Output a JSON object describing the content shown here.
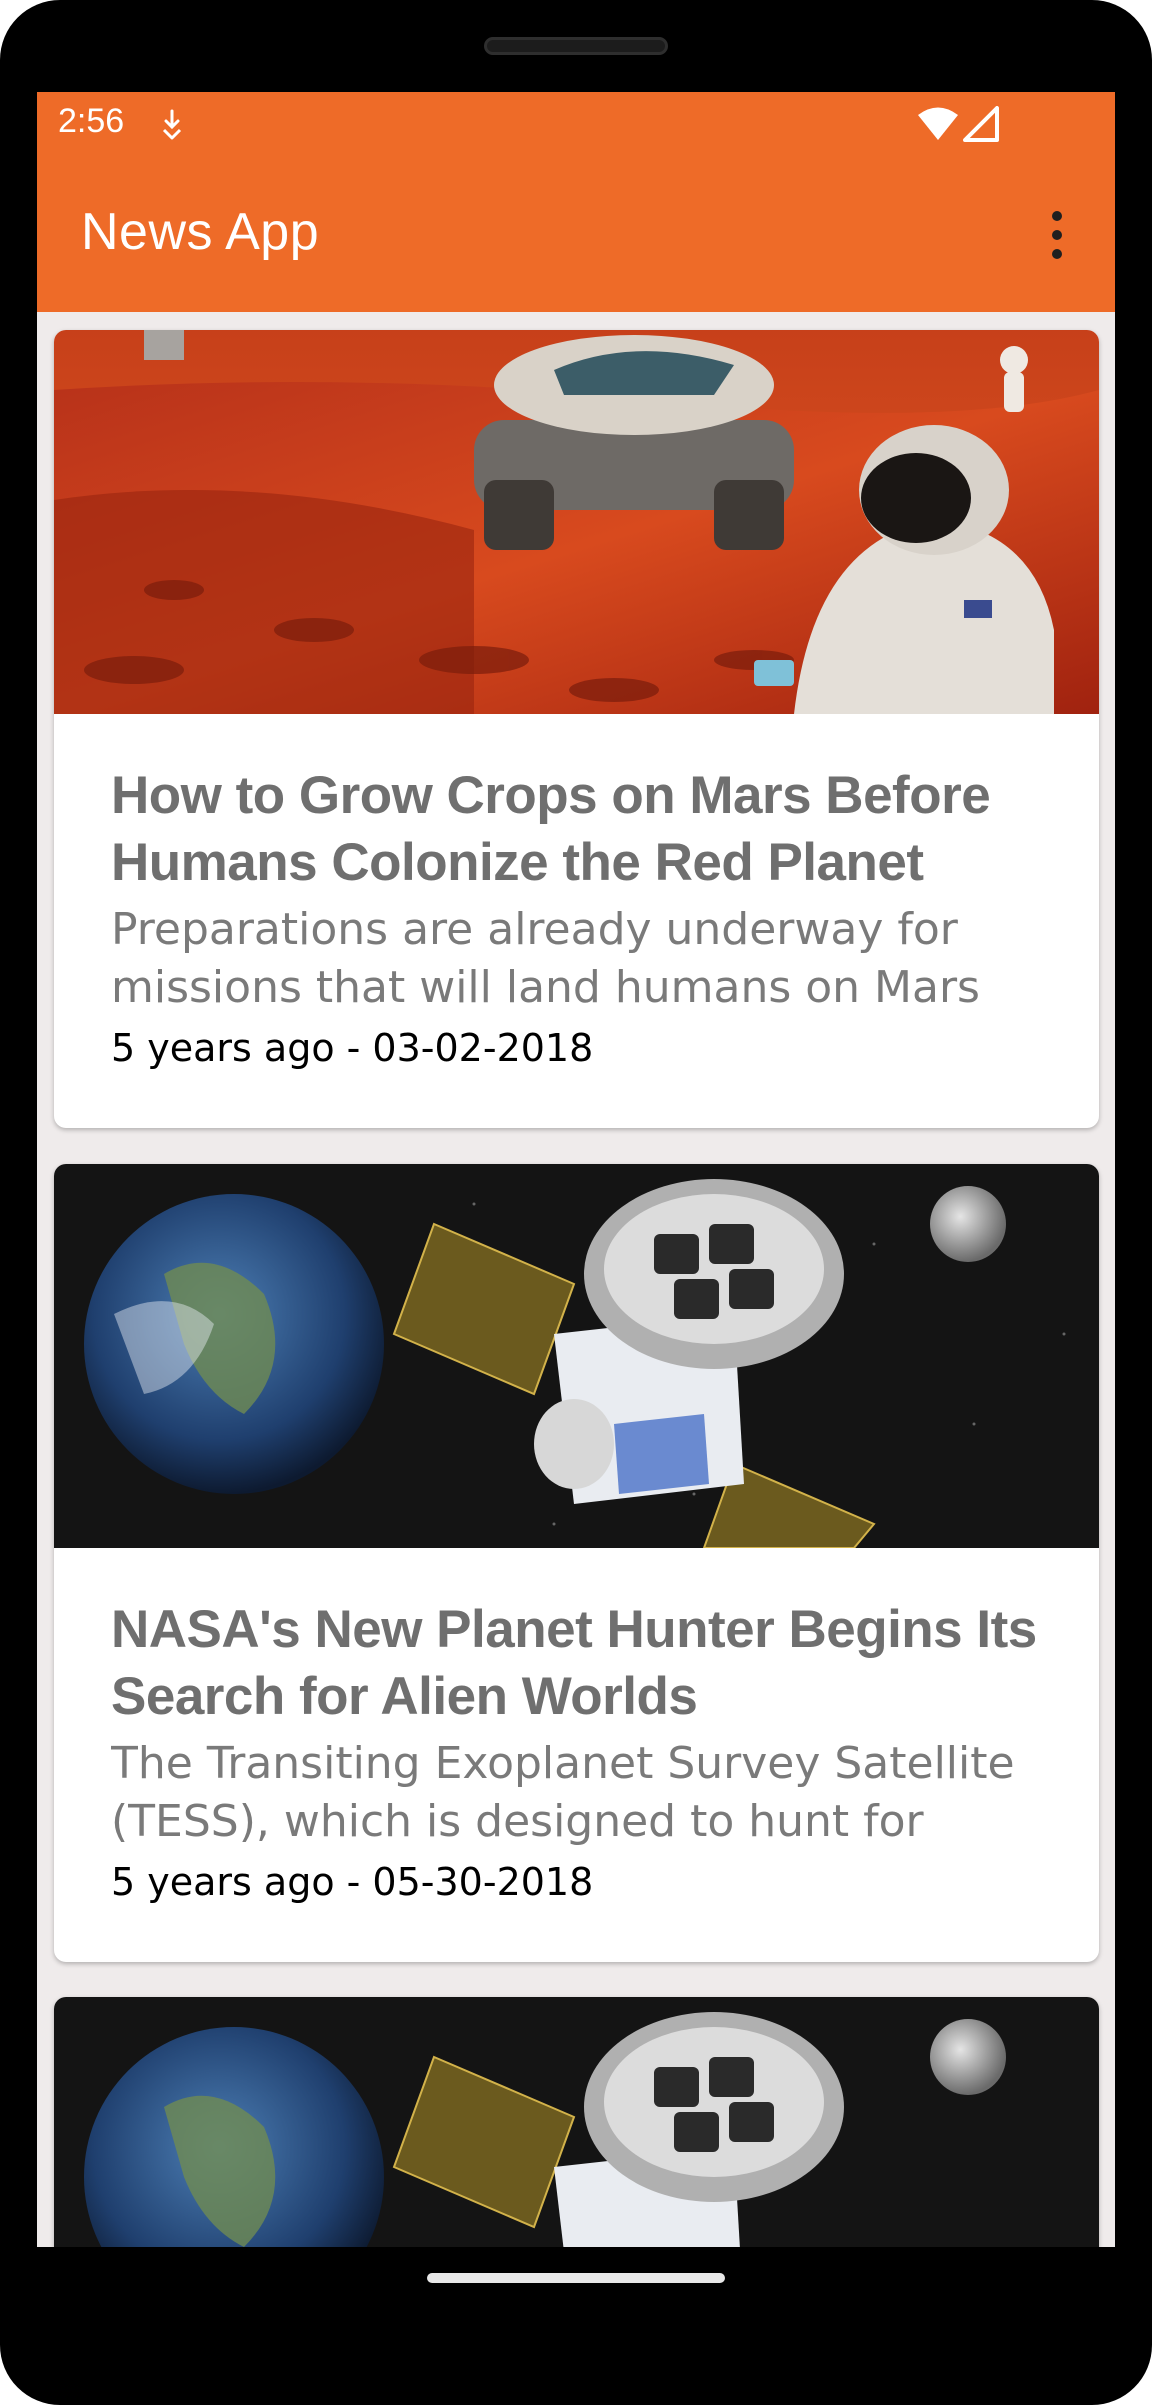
{
  "status_bar": {
    "time": "2:56",
    "background_color": "#ee6b28",
    "icons": [
      "download-icon",
      "wifi-icon",
      "signal-icon"
    ]
  },
  "app_bar": {
    "title": "News App",
    "menu_icon": "overflow-menu-icon"
  },
  "articles": [
    {
      "image": "mars-astronauts-image",
      "title": "How to Grow Crops on Mars Before Humans Colonize the Red Planet",
      "description": "Preparations are already underway for missions that will land humans on Mars",
      "date": "5 years ago - 03-02-2018"
    },
    {
      "image": "tess-satellite-image",
      "title": "NASA's New Planet Hunter Begins Its Search for Alien Worlds",
      "description": "The Transiting Exoplanet Survey Satellite (TESS), which is designed to hunt for",
      "date": "5 years ago - 05-30-2018"
    },
    {
      "image": "tess-satellite-image"
    }
  ],
  "colors": {
    "accent": "#ee6b28",
    "title_text": "#6f6f6f",
    "background": "#efebeb"
  }
}
